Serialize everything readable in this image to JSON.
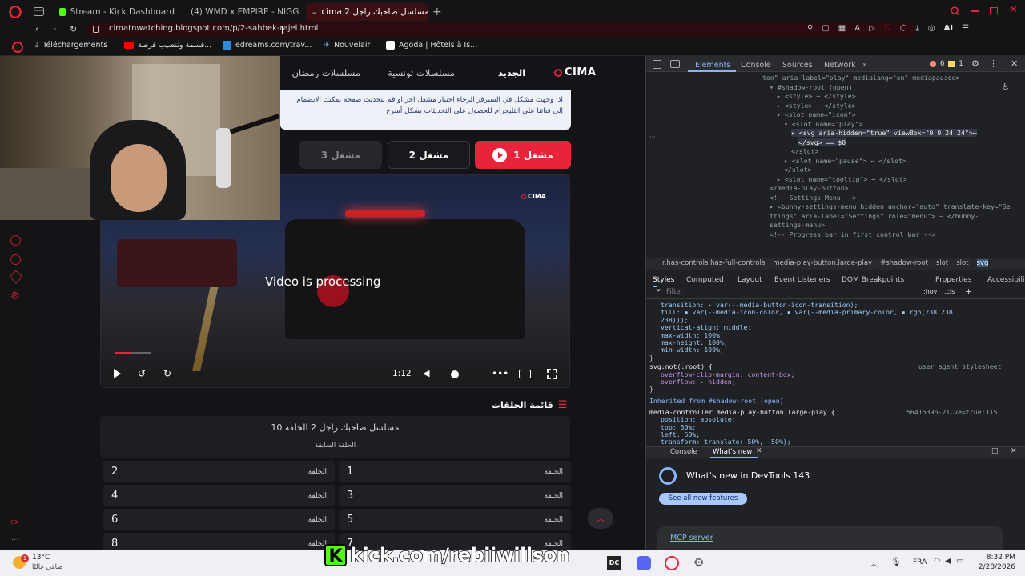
{
  "browser": {
    "tabs": [
      {
        "label": "Stream - Kick Dashboard",
        "icon": "kick-icon"
      },
      {
        "label": "(4) WMD x EMPIRE - NIGG",
        "icon": "youtube-icon"
      },
      {
        "label": "مسلسل صاحبك راجل 2 cima",
        "icon": "cima-icon",
        "active": true
      }
    ],
    "url": "cimatnwatching.blogspot.com/p/2-sahbek-rajel.html",
    "bookmarks": [
      {
        "label": "Téléchargements",
        "icon": "download-icon"
      },
      {
        "label": "قسمة وتنصيب فرصة...",
        "icon": "youtube-icon"
      },
      {
        "label": "edreams.com/trav...",
        "icon": "edreams-icon"
      },
      {
        "label": "Nouvelair",
        "icon": "plane-icon"
      },
      {
        "label": "Agoda | Hôtels à Is...",
        "icon": "agoda-icon"
      }
    ],
    "ai_label": "AI"
  },
  "site": {
    "logo": "CIMA",
    "nav": [
      "الجديد",
      "مسلسلات تونسية",
      "مسلسلات رمضان"
    ],
    "notice": "اذا وجهت مشكل في السيرفر الرجاء اختيار مشغل اخر او قم بتحديث صفحة يمكنك الانضمام إلى قناتنا على التليجرام للحصول على التحديثات بشكل أسرع",
    "servers": [
      "مشغل 1",
      "مشغل 2",
      "مشغل 3"
    ],
    "player": {
      "watermark": "CIMA",
      "status": "Video is processing",
      "time": "1:12",
      "progress": 0.08
    },
    "episodes_heading": "قائمة الحلقات",
    "series_title": "مسلسل صاحبك راجل 2 الحلقة 10",
    "prev_label": "الحلقة السابقة",
    "ep_label": "الحلقة",
    "episodes": [
      "1",
      "2",
      "3",
      "4",
      "5",
      "6",
      "7",
      "8"
    ]
  },
  "devtools": {
    "tabs": [
      "Elements",
      "Console",
      "Sources",
      "Network"
    ],
    "errors": "6",
    "warnings": "1",
    "dom_lines": [
      {
        "text": "ton\" aria-label=\"play\" medialang=\"en\" mediapaused>",
        "indent": 0
      },
      {
        "text": "▾ #shadow-root (open)",
        "indent": 1
      },
      {
        "text": "▸ <style> ⋯ </style>",
        "indent": 2
      },
      {
        "text": "▸ <style> ⋯ </style>",
        "indent": 2
      },
      {
        "text": "▾ <slot name=\"icon\">",
        "indent": 2
      },
      {
        "text": "▾ <slot name=\"play\">",
        "indent": 3
      },
      {
        "text": "▸ <svg aria-hidden=\"true\" viewBox=\"0 0 24 24\">⋯",
        "indent": 4
      },
      {
        "text": "</svg> == $0",
        "indent": 5
      },
      {
        "text": "</slot>",
        "indent": 4
      },
      {
        "text": "▸ <slot name=\"pause\"> ⋯ </slot>",
        "indent": 3
      },
      {
        "text": "</slot>",
        "indent": 3
      },
      {
        "text": "▸ <slot name=\"tooltip\"> ⋯ </slot>",
        "indent": 2
      },
      {
        "text": "</media-play-button>",
        "indent": 1
      },
      {
        "text": "<!-- Settings Menu -->",
        "indent": 1
      },
      {
        "text": "▸ <bunny-settings-menu hidden anchor=\"auto\" translate-key=\"Se",
        "indent": 1
      },
      {
        "text": "ttings\" aria-label=\"Settings\" role=\"menu\"> ⋯ </bunny-",
        "indent": 1
      },
      {
        "text": "settings-menu>",
        "indent": 1
      },
      {
        "text": "<!-- Progress bar in first control bar -->",
        "indent": 1
      }
    ],
    "breadcrumb": [
      "r.has-controls.has-full-controls",
      "media-play-button.large-play",
      "#shadow-root",
      "slot",
      "slot",
      "svg"
    ],
    "style_tabs": [
      "Styles",
      "Computed",
      "Layout",
      "Event Listeners",
      "DOM Breakpoints",
      "Properties",
      "Accessibility"
    ],
    "filter_placeholder": "Filter",
    "hov": ":hov",
    "cls": ".cls",
    "css_lines": [
      "transition: ▸ var(--media-button-icon-transition);",
      "fill: ▪ var(--media-icon-color, ▪ var(--media-primary-color, ▪ rgb(238 238",
      "   238)));",
      "vertical-align: middle;",
      "max-width: 100%;",
      "max-height: 100%;",
      "min-width: 100%;",
      "}"
    ],
    "rule2_selector": "svg:not(:root) {",
    "rule2_source": "user agent stylesheet",
    "rule2_lines": [
      "overflow-clip-margin: content-box;",
      "overflow: ▸ hidden;",
      "}"
    ],
    "inherited": "Inherited from #shadow-root (open)",
    "rule3_selector": "media-controller media-play-button.large-play {",
    "rule3_source": "5641539b-21…ve=true:115",
    "rule3_lines": [
      "position: absolute;",
      "top: 50%;",
      "left: 50%;",
      "transform: translate(-50%, -50%);"
    ],
    "drawer_tabs": [
      "Console",
      "What's new"
    ],
    "whats_new": "What's new in DevTools 143",
    "see_all": "See all new features",
    "mcp": "MCP server"
  },
  "taskbar": {
    "temp": "13°C",
    "weather": "صافي غالبًا",
    "lang": "FRA",
    "time": "8:32 PM",
    "date": "2/28/2026",
    "badge": "1"
  },
  "overlay": {
    "text": "kick.com/rebiiwillson"
  },
  "colors": {
    "accent": "#e8233a",
    "kick_green": "#53fc18",
    "devtools_bg": "#202124"
  }
}
